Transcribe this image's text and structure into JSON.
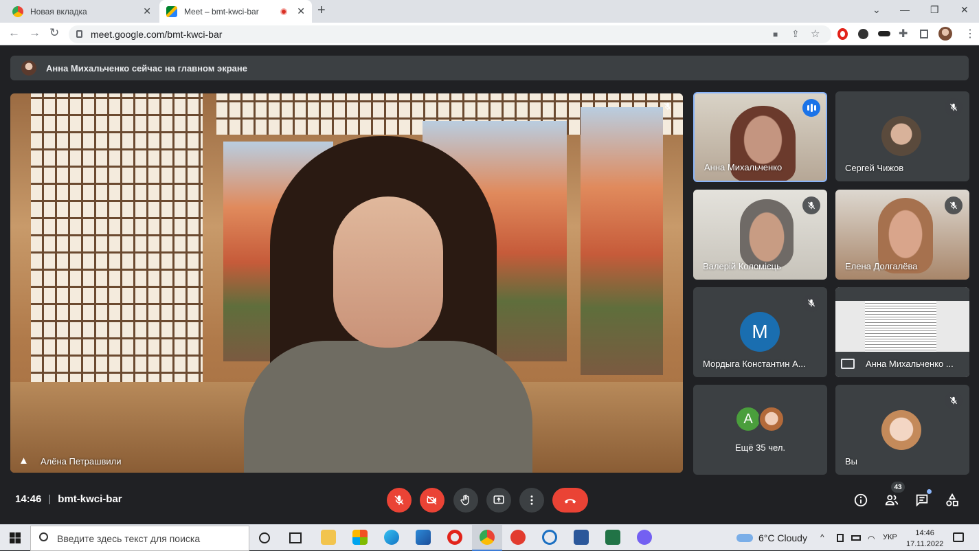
{
  "browser": {
    "tabs": [
      {
        "title": "Новая вкладка",
        "close": "✕"
      },
      {
        "title": "Meet – bmt-kwci-bar",
        "close": "✕"
      }
    ],
    "new_tab": "+",
    "window_controls": [
      "⌄",
      "—",
      "❐",
      "✕"
    ],
    "url": "meet.google.com/bmt-kwci-bar"
  },
  "meet": {
    "banner": "Анна Михальченко сейчас на главном экране",
    "main_speaker": "Алёна Петрашвили",
    "tiles": [
      {
        "name": "Анна Михальченко",
        "state": "speaking"
      },
      {
        "name": "Сергей Чижов",
        "state": "muted"
      },
      {
        "name": "Валерій Коломієць",
        "state": "muted"
      },
      {
        "name": "Елена Долгалёва",
        "state": "muted"
      },
      {
        "name": "Мордыга Константин А...",
        "state": "muted",
        "avatar_letter": "M",
        "avatar_color": "#1a6eb0"
      },
      {
        "name": "Анна Михальченко ...",
        "state": "presenting"
      },
      {
        "name": "Ещё 35 чел.",
        "avatar_letter": "A",
        "avatar_color": "#4a9e3c"
      },
      {
        "name": "Вы",
        "state": "muted"
      }
    ],
    "time": "14:46",
    "meeting_code": "bmt-kwci-bar",
    "participants_count": "43",
    "colors": {
      "hangup": "#ea4335",
      "panel": "#3c4043",
      "background": "#202124",
      "speaking_border": "#8ab4f8"
    }
  },
  "taskbar": {
    "search_placeholder": "Введите здесь текст для поиска",
    "weather": "6°C  Cloudy",
    "language": "УКР",
    "time": "14:46",
    "date": "17.11.2022"
  }
}
